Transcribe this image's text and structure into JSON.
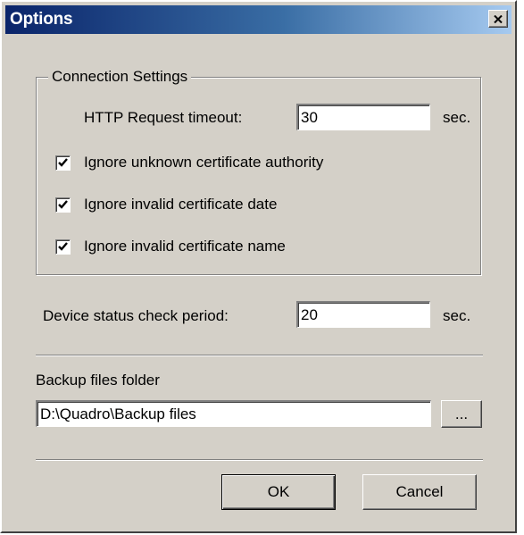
{
  "window": {
    "title": "Options",
    "close_label": "close"
  },
  "connection_settings": {
    "legend": "Connection Settings",
    "timeout_label": "HTTP Request timeout:",
    "timeout_value": "30",
    "timeout_unit": "sec.",
    "checkboxes": [
      {
        "label": "Ignore unknown certificate authority",
        "checked": true
      },
      {
        "label": "Ignore invalid certificate date",
        "checked": true
      },
      {
        "label": "Ignore invalid certificate name",
        "checked": true
      }
    ]
  },
  "device_status": {
    "label": "Device status check period:",
    "value": "20",
    "unit": "sec."
  },
  "backup": {
    "label": "Backup files folder",
    "path": "D:\\Quadro\\Backup files",
    "browse_label": "..."
  },
  "footer": {
    "ok_label": "OK",
    "cancel_label": "Cancel"
  },
  "colors": {
    "title_bar_start": "#0a246a",
    "title_bar_end": "#a6caf0",
    "dialog_face": "#d4d0c8"
  }
}
